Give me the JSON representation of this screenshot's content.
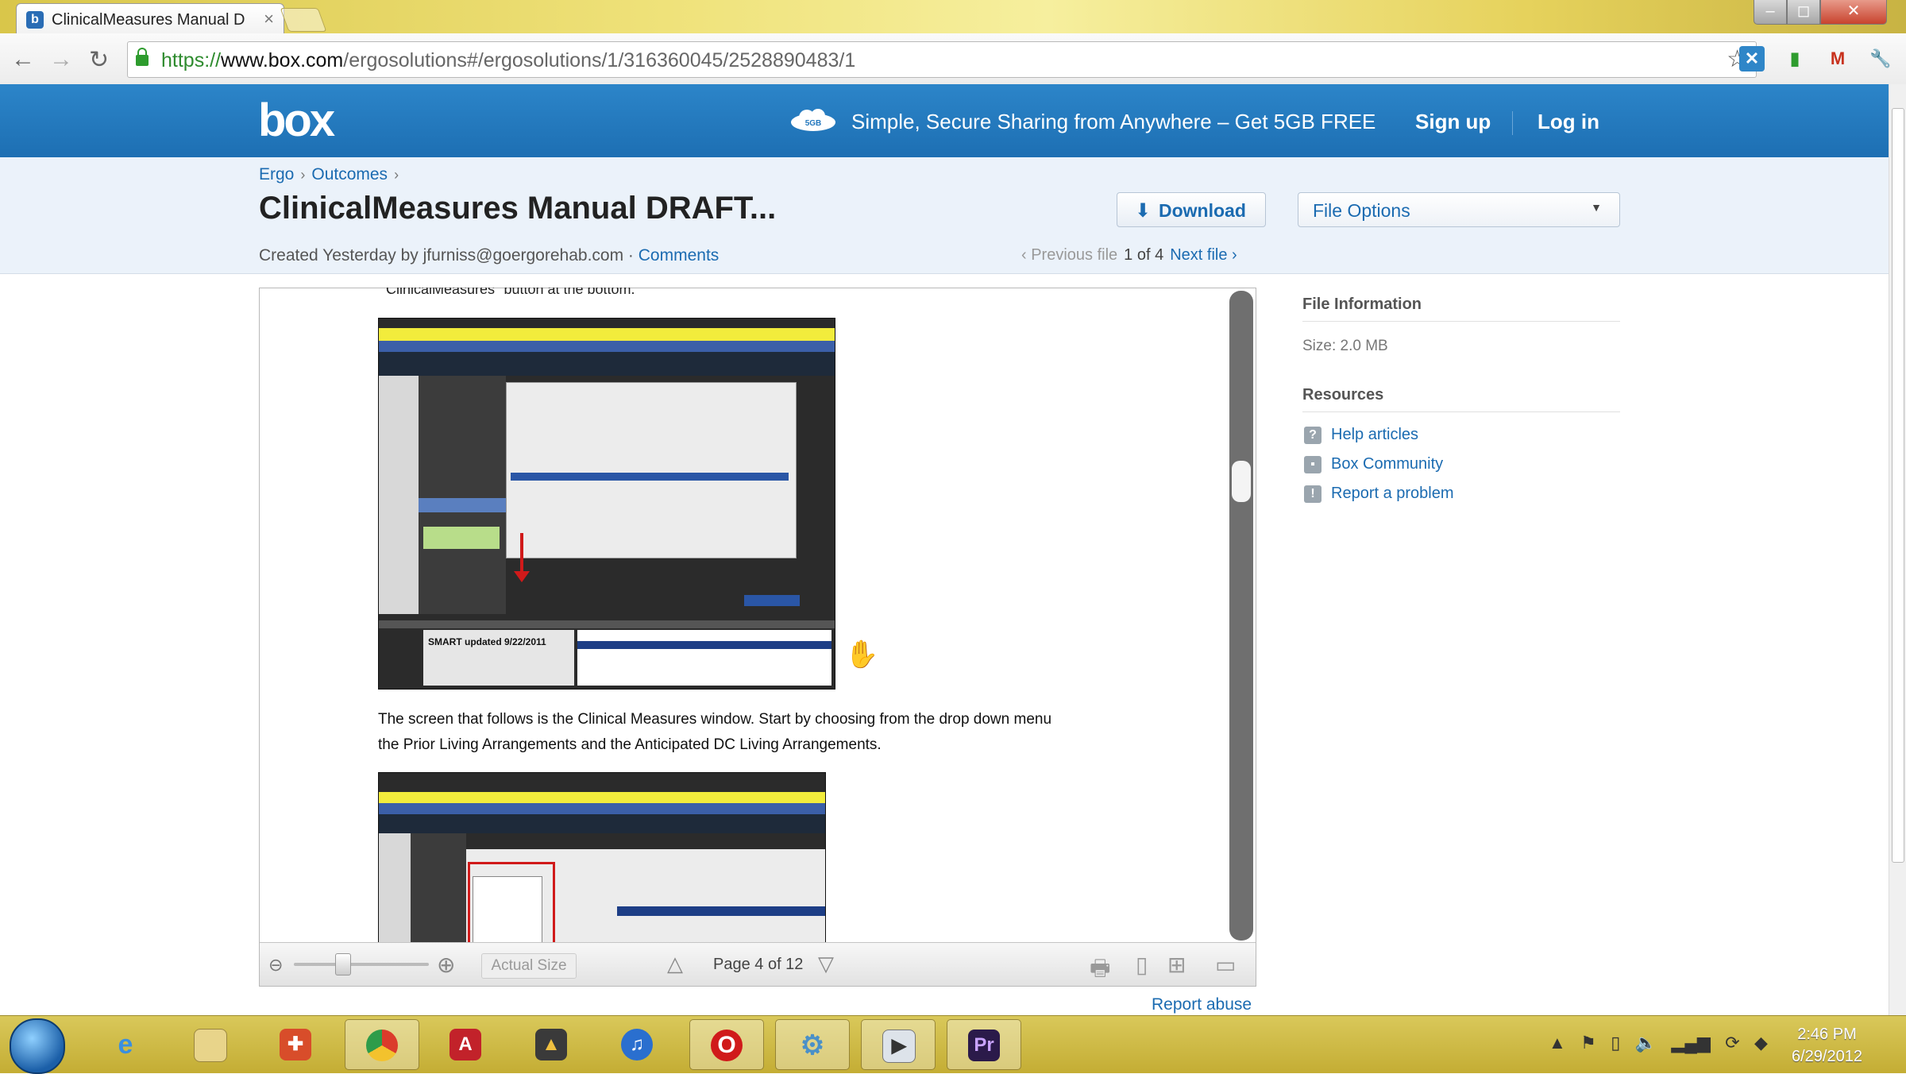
{
  "browser": {
    "tab_title": "ClinicalMeasures Manual D",
    "tab_favicon": "b",
    "url_scheme": "https://",
    "url_domain": "www.box.com",
    "url_path": "/ergosolutions#/ergosolutions/1/316360045/2528890483/1",
    "back_icon": "back-arrow-icon",
    "forward_icon": "forward-arrow-icon",
    "reload_icon": "reload-icon",
    "star_icon": "bookmark-star-icon",
    "window_buttons": [
      "minimize",
      "maximize",
      "close"
    ]
  },
  "header": {
    "logo": "box",
    "promo": "Simple, Secure Sharing from Anywhere – Get 5GB FREE",
    "signup": "Sign up",
    "login": "Log in",
    "accent_color": "#2277bd"
  },
  "file": {
    "breadcrumb": [
      "Ergo",
      "Outcomes"
    ],
    "title": "ClinicalMeasures Manual DRAFT...",
    "download_label": "Download",
    "file_options_label": "File Options",
    "created_text": "Created Yesterday by jfurniss@goergorehab.com",
    "comments_link": "Comments",
    "previous_file": "‹ Previous file",
    "file_position": "1 of 4",
    "next_file": "Next file ›"
  },
  "viewer": {
    "cut_text": "ClinicalMeasures\" button at the bottom.",
    "screenshot1_label": "SMART updated 9/22/2011",
    "paragraph": [
      "The screen that follows is the Clinical Measures window.  Start by choosing from the drop down menu",
      "the Prior Living Arrangements and the Anticipated DC Living Arrangements."
    ],
    "toolbar": {
      "actual_size": "Actual Size",
      "page_label": "Page 4 of 12",
      "current_page": 4,
      "total_pages": 12
    },
    "report_abuse": "Report abuse"
  },
  "sidebar": {
    "file_info_heading": "File Information",
    "size": "Size: 2.0 MB",
    "resources_heading": "Resources",
    "resources": [
      "Help articles",
      "Box Community",
      "Report a problem"
    ]
  },
  "taskbar": {
    "apps": [
      "windows-start",
      "internet-explorer",
      "file-explorer",
      "media-center",
      "chrome",
      "acrobat",
      "graduation-app",
      "itunes",
      "opera",
      "settings-app",
      "video-app",
      "premiere"
    ],
    "time": "2:46 PM",
    "date": "6/29/2012"
  }
}
